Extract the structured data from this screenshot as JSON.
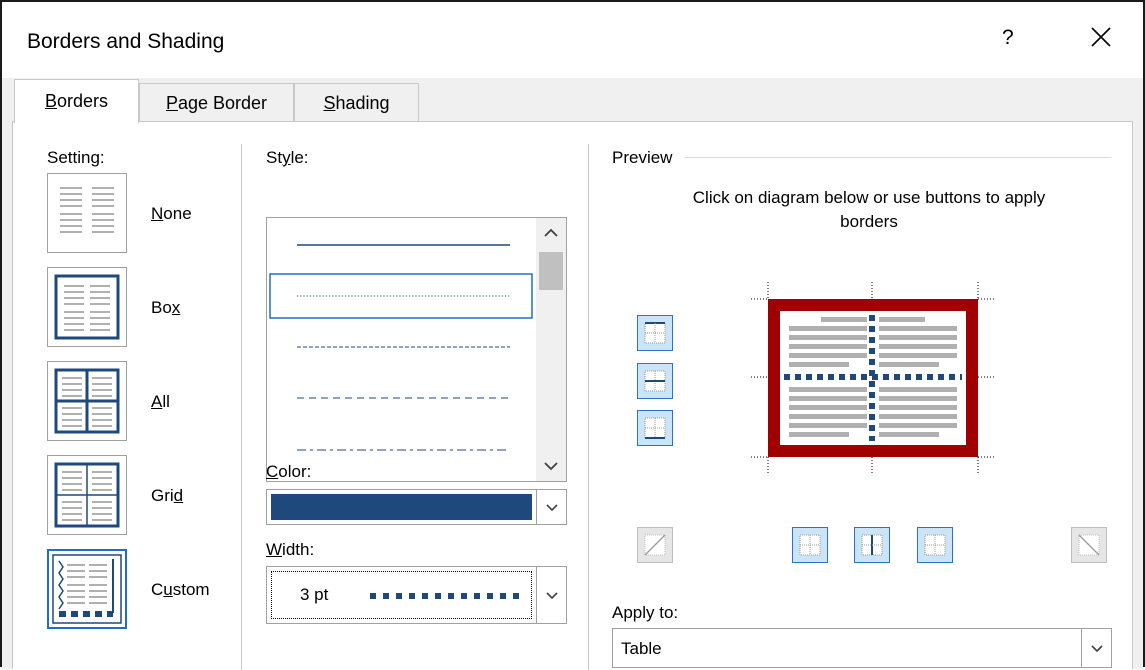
{
  "dialog": {
    "title": "Borders and Shading",
    "help_label": "?"
  },
  "tabs": [
    {
      "label": "Borders",
      "mnemonic": "B",
      "active": true
    },
    {
      "label": "Page Border",
      "mnemonic": "P",
      "active": false
    },
    {
      "label": "Shading",
      "mnemonic": "S",
      "active": false
    }
  ],
  "setting": {
    "heading": "Setting:",
    "options": [
      {
        "label": "None",
        "mnemonic": "N"
      },
      {
        "label": "Box",
        "mnemonic": "x"
      },
      {
        "label": "All",
        "mnemonic": "A"
      },
      {
        "label": "Grid",
        "mnemonic": "d"
      },
      {
        "label": "Custom",
        "mnemonic": "u"
      }
    ],
    "selected": "Custom"
  },
  "style": {
    "heading": "Style:",
    "line_styles": [
      "solid",
      "dotted",
      "dashed-small",
      "dashed",
      "dash-dot"
    ],
    "selected": "dotted"
  },
  "color": {
    "heading": "Color:",
    "value": "#1f497d"
  },
  "width": {
    "heading": "Width:",
    "value": "3 pt"
  },
  "preview": {
    "heading": "Preview",
    "instruction": "Click on diagram below or use buttons to apply borders",
    "outer_border_color": "#a00000",
    "inner_border_color": "#1f497d"
  },
  "apply_to": {
    "heading": "Apply to:",
    "value": "Table"
  }
}
